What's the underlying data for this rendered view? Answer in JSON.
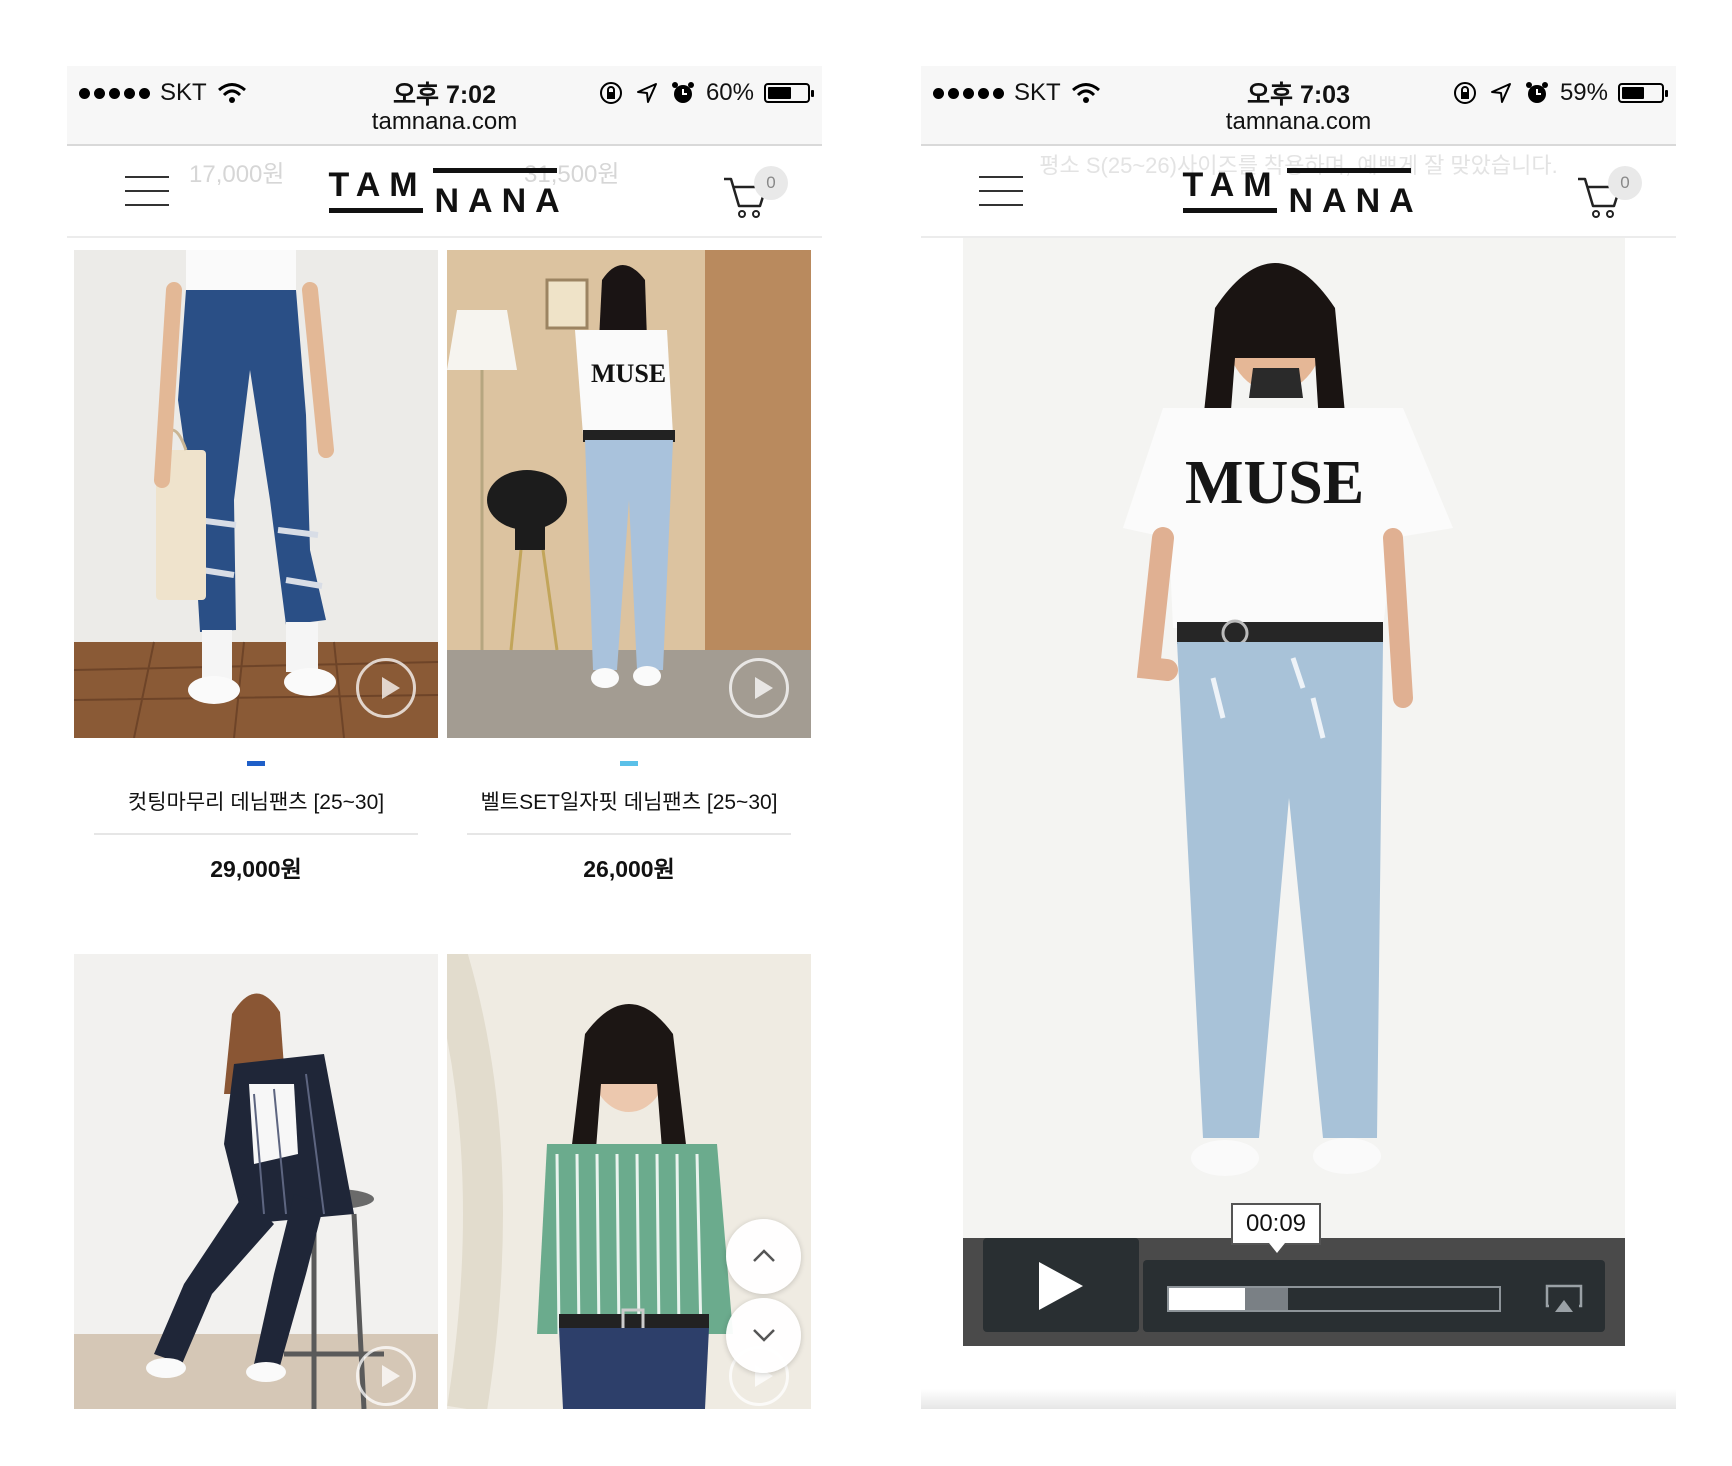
{
  "left_screen": {
    "status": {
      "carrier": "SKT",
      "time": "오후 7:02",
      "battery_percent": "60%",
      "battery_level": 0.6,
      "icons": [
        "signal-dots-icon",
        "wifi-icon",
        "rotation-lock-icon",
        "location-arrow-icon",
        "alarm-icon",
        "battery-icon"
      ]
    },
    "url": "tamnana.com",
    "header": {
      "logo_top": "TAM",
      "logo_bottom": "NANA",
      "cart_count": "0",
      "faded_prices": [
        "17,000원",
        "31,500원"
      ]
    },
    "products": [
      {
        "name": "컷팅마무리 데님팬츠 [25~30]",
        "price": "29,000원",
        "color_chip": "#1f5fc8",
        "image": "model in dark blue ripped denim, white sneakers, tote bag",
        "has_video": true
      },
      {
        "name": "벨트SET일자핏 데님팬츠 [25~30]",
        "price": "26,000원",
        "color_chip": "#5bc0e8",
        "image": "model in MUSE tee and light blue jeans",
        "has_video": true
      },
      {
        "name": "",
        "price": "",
        "image": "model in pinstripe jacket and trousers on stool",
        "has_video": true
      },
      {
        "name": "",
        "price": "",
        "image": "model in green striped blouse and jeans",
        "has_video": true
      }
    ],
    "scroll_buttons": [
      "chevron-up-icon",
      "chevron-down-icon"
    ]
  },
  "right_screen": {
    "status": {
      "carrier": "SKT",
      "time": "오후 7:03",
      "battery_percent": "59%",
      "battery_level": 0.59
    },
    "url": "tamnana.com",
    "header": {
      "logo_top": "TAM",
      "logo_bottom": "NANA",
      "cart_count": "0",
      "faded_note": "평소 S(25~26)사이즈를 착용하며, 예쁘게 잘 맞았습니다."
    },
    "video": {
      "current_time": "00:09",
      "progress": 0.23,
      "buffered": 0.36,
      "image": "model in MUSE tee and light blue jeans, full length"
    }
  }
}
